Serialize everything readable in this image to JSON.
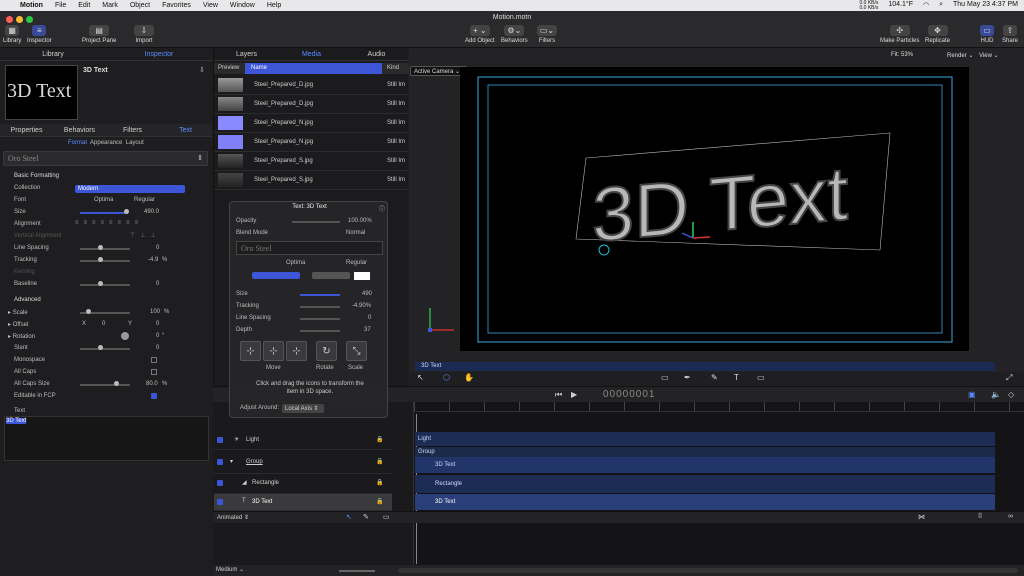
{
  "menubar": {
    "apple": "",
    "app": "Motion",
    "items": [
      "File",
      "Edit",
      "Mark",
      "Object",
      "Favorites",
      "View",
      "Window",
      "Help"
    ],
    "status": {
      "net_up": "0.0 KB/s",
      "net_down": "0.0 KB/s",
      "temp": "104.1°F",
      "datetime": "Thu May 23  4:37 PM"
    }
  },
  "toolbar": {
    "doc_title": "Motion.motn",
    "library": "Library",
    "inspector": "Inspector",
    "project_pane": "Project Pane",
    "import": "Import",
    "add_object": "Add Object",
    "behaviors": "Behaviors",
    "filters": "Filters",
    "make_particles": "Make Particles",
    "replicate": "Replicate",
    "hud": "HUD",
    "share": "Share"
  },
  "left": {
    "tab_library": "Library",
    "tab_inspector": "Inspector",
    "preview_title": "3D Text",
    "preview_text": "3D Text",
    "subtabs": [
      "Properties",
      "Behaviors",
      "Filters",
      "Text"
    ],
    "format_tabs": [
      "Format",
      "Appearance",
      "Layout"
    ],
    "preset": "Oro Steel",
    "basic_formatting": "Basic Formatting",
    "collection_label": "Collection",
    "collection_value": "Modern",
    "font_label": "Font",
    "font_value": "Optima",
    "font_style": "Regular",
    "size_label": "Size",
    "size_value": "490.0",
    "alignment_label": "Alignment",
    "vertical_alignment_label": "Vertical Alignment",
    "line_spacing_label": "Line Spacing",
    "line_spacing_value": "0",
    "tracking_label": "Tracking",
    "tracking_value": "-4.9",
    "tracking_unit": "%",
    "kerning_label": "Kerning",
    "baseline_label": "Baseline",
    "baseline_value": "0",
    "advanced": "Advanced",
    "scale_label": "Scale",
    "scale_value": "100",
    "scale_unit": "%",
    "offset_label": "Offset",
    "offset_x_label": "X",
    "offset_x": "0",
    "offset_y_label": "Y",
    "offset_y": "0",
    "rotation_label": "Rotation",
    "rotation_value": "0",
    "rotation_unit": "°",
    "slant_label": "Slant",
    "slant_value": "0",
    "monospace_label": "Monospace",
    "all_caps_label": "All Caps",
    "all_caps_size_label": "All Caps Size",
    "all_caps_size_value": "80.0",
    "all_caps_size_unit": "%",
    "editable_label": "Editable in FCP",
    "text_label": "Text",
    "text_value": "3D Text"
  },
  "media": {
    "tabs": [
      "Layers",
      "Media",
      "Audio"
    ],
    "columns": [
      "Preview",
      "Name",
      "Kind"
    ],
    "files": [
      {
        "name": "Steel_Prepared_D.jpg",
        "kind": "Still Im"
      },
      {
        "name": "Steel_Prepared_D.jpg",
        "kind": "Still Im"
      },
      {
        "name": "Steel_Prepared_N.jpg",
        "kind": "Still Im"
      },
      {
        "name": "Steel_Prepared_N.jpg",
        "kind": "Still Im"
      },
      {
        "name": "Steel_Prepared_S.jpg",
        "kind": "Still Im"
      },
      {
        "name": "Steel_Prepared_S.jpg",
        "kind": "Still Im"
      }
    ]
  },
  "hud": {
    "title": "Text: 3D Text",
    "opacity_label": "Opacity",
    "opacity_value": "100.00%",
    "blend_label": "Blend Mode",
    "blend_value": "Normal",
    "preset": "Oro Steel",
    "font": "Optima",
    "style": "Regular",
    "size_label": "Size",
    "size_value": "490",
    "tracking_label": "Tracking",
    "tracking_value": "-4.90%",
    "line_spacing_label": "Line Spacing",
    "line_spacing_value": "0",
    "depth_label": "Depth",
    "depth_value": "37",
    "move": "Move",
    "rotate": "Rotate",
    "scale": "Scale",
    "hint": "Click and drag the icons to transform the item in 3D space.",
    "adjust_label": "Adjust Around:",
    "adjust_value": "Local Axis"
  },
  "canvas": {
    "fit": "Fit: 53%",
    "render": "Render",
    "view": "View",
    "camera": "Active Camera",
    "text": "3D Text",
    "mini_label": "3D Text"
  },
  "timeline": {
    "timecode": "00000001",
    "layers": [
      {
        "name": "Light"
      },
      {
        "name": "Group"
      },
      {
        "name": "Rectangle"
      },
      {
        "name": "3D Text"
      }
    ],
    "bars": [
      {
        "label": "Light"
      },
      {
        "label": "Group"
      },
      {
        "label": "3D Text"
      },
      {
        "label": "Rectangle"
      },
      {
        "label": "3D Text"
      }
    ],
    "footer_mode": "Animated",
    "zoom_label": "Medium"
  },
  "colors": {
    "accent": "#3d56d8",
    "selection": "#5a8cff",
    "canvas": "#000000"
  }
}
